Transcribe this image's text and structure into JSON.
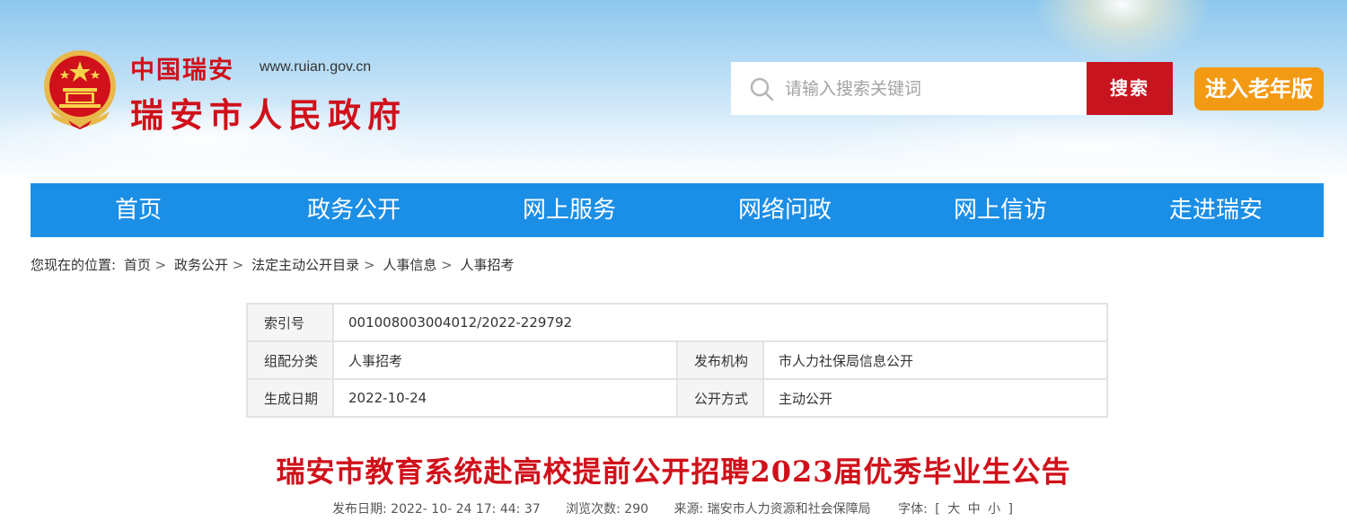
{
  "header": {
    "brand_top": "中国瑞安",
    "brand_url": "www.ruian.gov.cn",
    "brand_main": "瑞安市人民政府",
    "search_placeholder": "请输入搜索关键词",
    "search_button": "搜索",
    "elder_button": "进入老年版",
    "colors": {
      "brand_red": "#d0101a",
      "search_red": "#c8141e",
      "elder_orange": "#f39a14",
      "nav_blue": "#1b8ee6"
    }
  },
  "nav": {
    "items": [
      "首页",
      "政务公开",
      "网上服务",
      "网络问政",
      "网上信访",
      "走进瑞安"
    ]
  },
  "breadcrumb": {
    "prefix": "您现在的位置:",
    "items": [
      "首页",
      "政务公开",
      "法定主动公开目录",
      "人事信息",
      "人事招考"
    ],
    "separator": ">"
  },
  "meta": {
    "index_label": "索引号",
    "index_value": "001008003004012/2022-229792",
    "category_label": "组配分类",
    "category_value": "人事招考",
    "publisher_label": "发布机构",
    "publisher_value": "市人力社保局信息公开",
    "date_label": "生成日期",
    "date_value": "2022-10-24",
    "method_label": "公开方式",
    "method_value": "主动公开"
  },
  "article": {
    "title": "瑞安市教育系统赴高校提前公开招聘2023届优秀毕业生公告",
    "publish_label": "发布日期:",
    "publish_value": "2022- 10- 24 17: 44: 37",
    "views_label": "浏览次数:",
    "views_value": "290",
    "source_label": "来源:",
    "source_value": "瑞安市人力资源和社会保障局",
    "font_label": "字体:",
    "font_open": "[",
    "font_large": "大",
    "font_medium": "中",
    "font_small": "小",
    "font_close": "]"
  }
}
